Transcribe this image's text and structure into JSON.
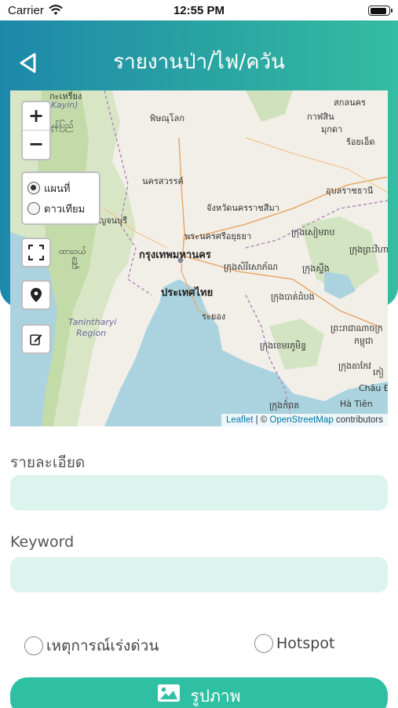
{
  "status_bar": {
    "carrier": "Carrier",
    "time": "12:55 PM",
    "battery_level": 0.92
  },
  "header": {
    "title": "รายงานป่า/ไฟ/ควัน",
    "gradient_start": "#1d88aa",
    "gradient_end": "#35bca2"
  },
  "map": {
    "zoom_in": "+",
    "zoom_out": "−",
    "layers": [
      {
        "label": "แผนที่",
        "selected": true
      },
      {
        "label": "ดาวเทียม",
        "selected": false
      }
    ],
    "controls": [
      "fullscreen-icon",
      "location-pin-icon",
      "edit-icon"
    ],
    "attribution": {
      "leaflet": "Leaflet",
      "separator": " | © ",
      "osm": "OpenStreetMap",
      "suffix": " contributors"
    },
    "labels": {
      "kayin_th": "กะเหรี่ยง",
      "kayin": "Kayin)",
      "mon": "မွန်ပြည်",
      "phitsanulok": "พิษณุโลก",
      "sakon": "สกลนคร",
      "kalasin": "กาฬสิน",
      "mukdahan": "มุกดา",
      "roiet": "ร้อยเอ็ด",
      "nakhonsawan": "นครสวรรค์",
      "ubon": "อุบลราชธานี",
      "korat": "จังหวัดนครราชสีมา",
      "kanchanaburi": "กาญจนบุรี",
      "ayutthaya": "พระนครศรีอยุธยา",
      "siemreap": "ក្រុងសៀមរាប",
      "dawei": "ထားဝယ်",
      "dawei2": "မြို့",
      "bangkok": "กรุงเทพมหานคร",
      "sisophon": "ក្រុងសិរីសោភ័ណ",
      "stungtreng": "ក្រុងស្ទឹង",
      "preahvihear": "ក្រុងព្រះវិហារ",
      "thailand": "ประเทศไทย",
      "battambang": "ក្រុងបាត់ដំបង",
      "rayong": "ระยอง",
      "tanintharyi": "Tanintharyi",
      "region": "Region",
      "phnompenh_th": "ព្រះរាជាណាចក្រ",
      "cambodia": "កម្ពុជា",
      "kohkong": "ក្រុងខេមរភូមិន្ទ",
      "takeo": "ក្រុងតាកែវ",
      "chaudoc": "Châu Đốc",
      "kampot": "ក្រុងកំពត",
      "hatien": "Hà Tiên",
      "kie": "កៀ"
    }
  },
  "form": {
    "detail_label": "รายละเอียด",
    "detail_value": "",
    "keyword_label": "Keyword",
    "keyword_value": "",
    "options": [
      {
        "label": "เหตุการณ์เร่งด่วน",
        "selected": false
      },
      {
        "label": "Hotspot",
        "selected": false
      }
    ],
    "photo_button": "รูปภาพ",
    "accent_color": "#2fbfa2",
    "input_bg": "#dcf3ee"
  }
}
